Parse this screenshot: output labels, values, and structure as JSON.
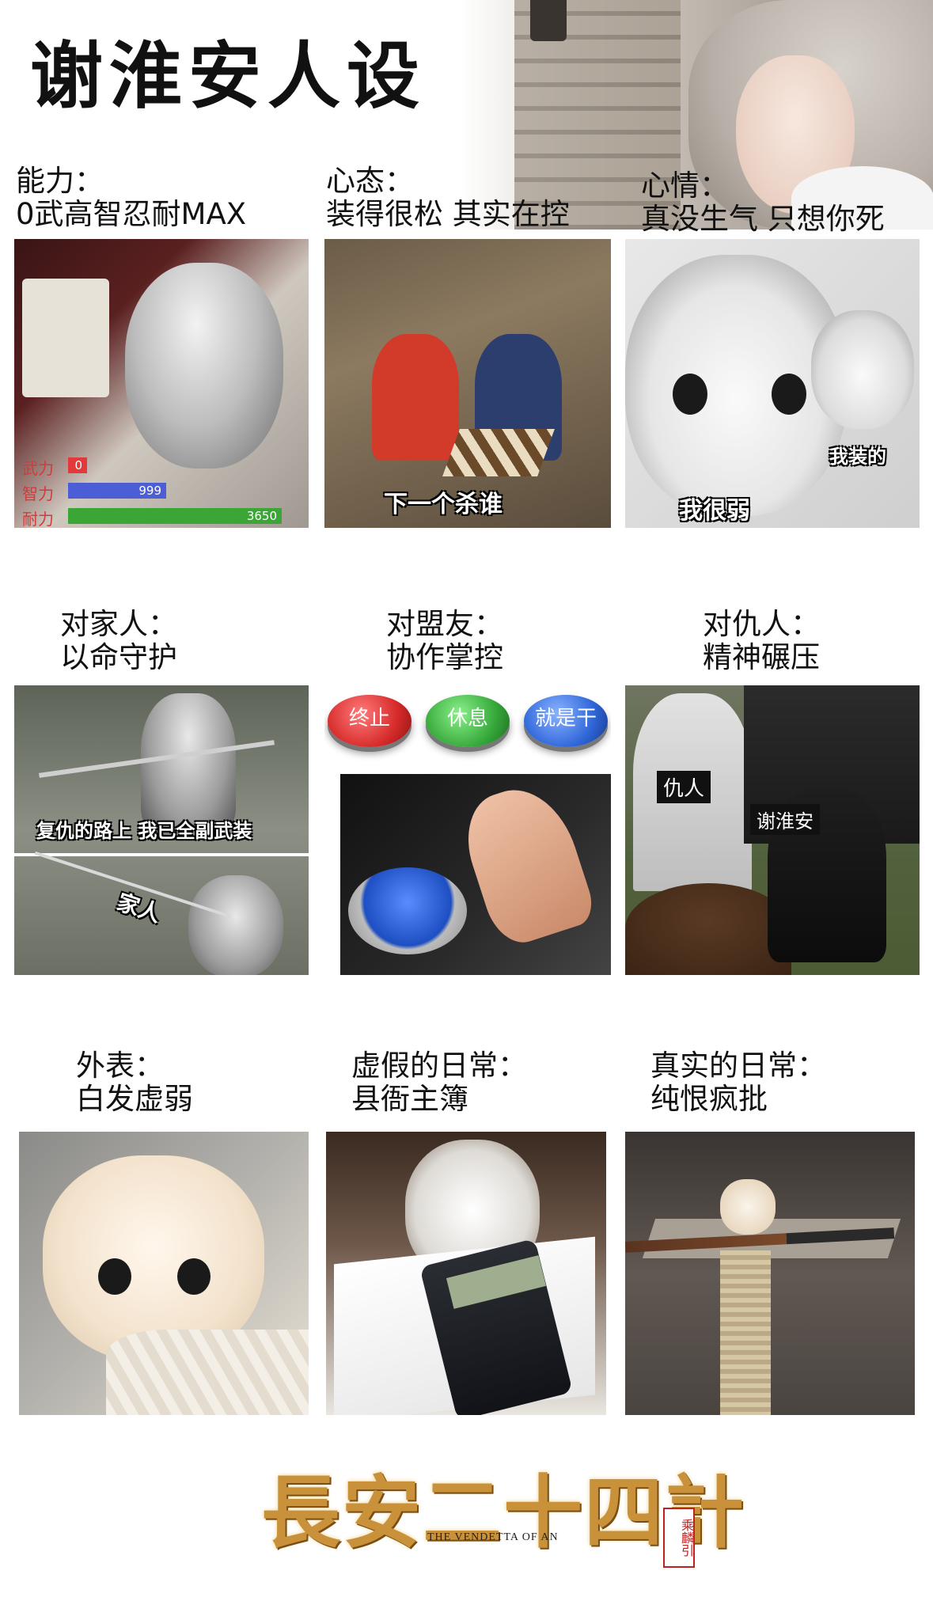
{
  "page_title": "谢淮安人设",
  "sections": [
    {
      "caption": "能力：\n0武高智忍耐MAX",
      "stats": [
        {
          "label": "武力",
          "value": "0",
          "fraction": 0.02,
          "color": "#e23a3a"
        },
        {
          "label": "智力",
          "value": "999",
          "fraction": 0.4,
          "color": "#4b5ed6"
        },
        {
          "label": "耐力",
          "value": "3650",
          "fraction": 0.85,
          "color": "#3ba635"
        }
      ]
    },
    {
      "caption": "心态：\n装得很松 其实在控",
      "overlay": "下一个杀谁"
    },
    {
      "caption": "心情：\n真没生气 只想你死",
      "overlay_main": "我很弱",
      "overlay_side": "我装的"
    },
    {
      "caption": "对家人：\n以命守护",
      "overlay_top": "复仇的路上 我已全副武装",
      "overlay_bottom": "家人"
    },
    {
      "caption": "对盟友：\n协作掌控",
      "buttons": [
        {
          "label": "终止",
          "color": "#d62a2a"
        },
        {
          "label": "休息",
          "color": "#36a83a"
        },
        {
          "label": "就是干",
          "color": "#2f66d8"
        }
      ]
    },
    {
      "caption": "对仇人：\n精神碾压",
      "tag_grave": "仇人",
      "tag_person": "谢淮安"
    },
    {
      "caption": "外表：\n白发虚弱"
    },
    {
      "caption": "虚假的日常：\n县衙主簿"
    },
    {
      "caption": "真实的日常：\n纯恨疯批"
    }
  ],
  "logo": {
    "title": "長安二十四計",
    "subtitle": "THE VENDETTA OF AN",
    "seal": "乘麟引"
  },
  "colors": {
    "logo_gold": "#c9923a",
    "stat_label": "#d03b3b"
  }
}
